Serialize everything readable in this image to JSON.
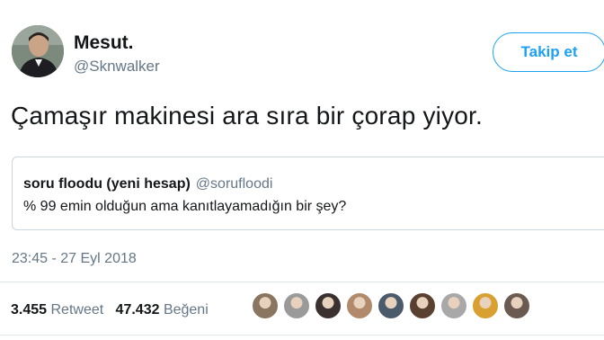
{
  "author": {
    "name": "Mesut.",
    "handle": "@Sknwalker"
  },
  "follow_button": {
    "label": "Takip et"
  },
  "tweet": {
    "text": "Çamaşır makinesi ara sıra bir çorap yiyor.",
    "timestamp": "23:45 - 27 Eyl 2018"
  },
  "quoted_tweet": {
    "name": "soru floodu (yeni hesap)",
    "handle": "@sorufloodi",
    "text": "% 99 emin olduğun ama kanıtlayamadığın bir şey?"
  },
  "stats": {
    "retweets_count": "3.455",
    "retweets_label": "Retweet",
    "likes_count": "47.432",
    "likes_label": "Beğeni"
  },
  "likers": [
    {
      "color": "#8a7560"
    },
    {
      "color": "#9a9a9a"
    },
    {
      "color": "#3a3030"
    },
    {
      "color": "#b08a6a"
    },
    {
      "color": "#4a5a6a"
    },
    {
      "color": "#5a4030"
    },
    {
      "color": "#a8a8a8"
    },
    {
      "color": "#d8a030"
    },
    {
      "color": "#6a5a50"
    }
  ]
}
